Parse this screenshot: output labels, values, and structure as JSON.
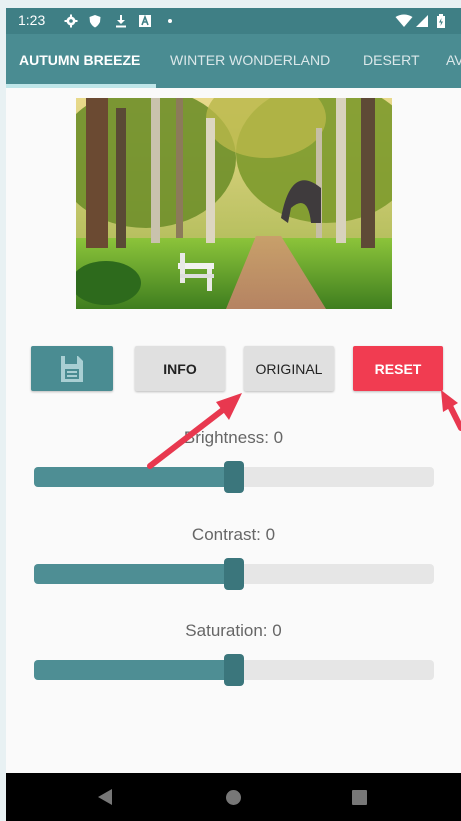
{
  "status_bar": {
    "time": "1:23",
    "icons": [
      "gear-icon",
      "shield-icon",
      "download-icon",
      "a-icon",
      "dot-icon",
      "wifi-icon",
      "signal-icon",
      "battery-icon"
    ]
  },
  "tabs": [
    {
      "label": "AUTUMN BREEZE",
      "active": true
    },
    {
      "label": "WINTER WONDERLAND",
      "active": false
    },
    {
      "label": "DESERT",
      "active": false
    },
    {
      "label": "AV",
      "active": false
    }
  ],
  "buttons": {
    "save_icon": "save-icon",
    "info": "INFO",
    "original": "ORIGINAL",
    "reset": "RESET"
  },
  "sliders": [
    {
      "label": "Brightness: 0",
      "value_fraction": 0.5
    },
    {
      "label": "Contrast: 0",
      "value_fraction": 0.5
    },
    {
      "label": "Saturation: 0",
      "value_fraction": 0.5
    }
  ],
  "colors": {
    "primary": "#4a8c92",
    "primary_dark": "#3f7f85",
    "accent": "#f13c51",
    "annotation_arrow": "#e8384f"
  },
  "nav_bar": [
    "back-icon",
    "home-icon",
    "recents-icon"
  ]
}
